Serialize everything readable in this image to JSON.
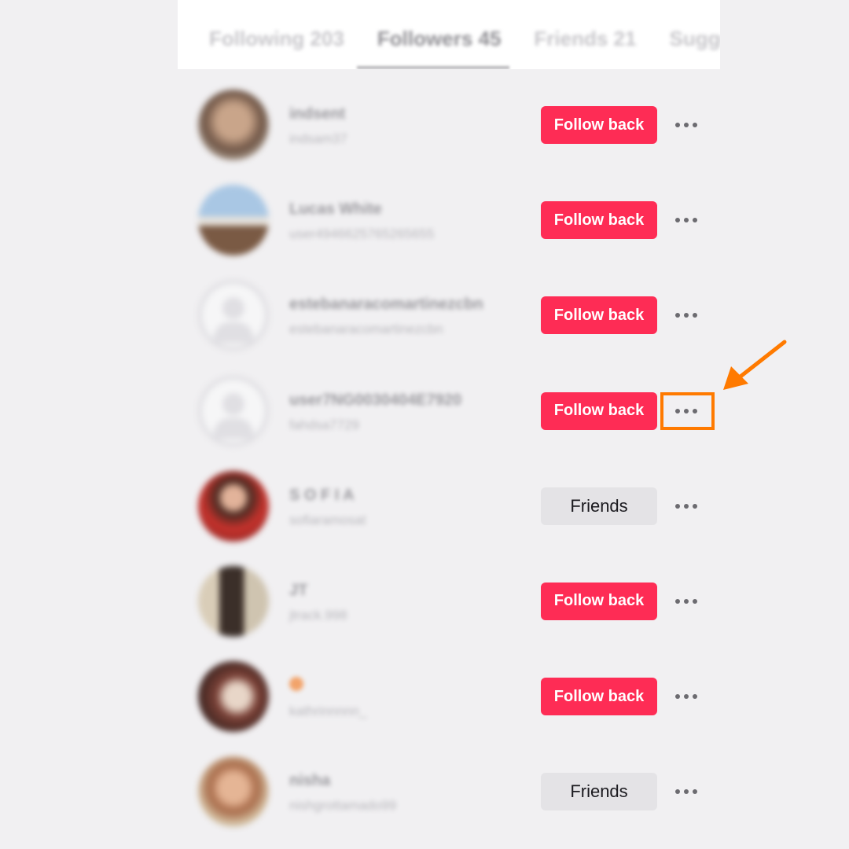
{
  "tabs": [
    {
      "label": "Following 203",
      "active": false
    },
    {
      "label": "Followers 45",
      "active": true
    },
    {
      "label": "Friends 21",
      "active": false
    },
    {
      "label": "Suggested",
      "active": false
    }
  ],
  "followers": [
    {
      "display_name": "indsent",
      "username": "indsam37",
      "button": "Follow back",
      "button_type": "follow",
      "avatar_color": "#9a7b64"
    },
    {
      "display_name": "Lucas White",
      "username": "user4946625765265655",
      "button": "Follow back",
      "button_type": "follow",
      "avatar_color": "#8ba9c8"
    },
    {
      "display_name": "estebanaracomartinezcbn",
      "username": "estebanaracomartinezcbn",
      "button": "Follow back",
      "button_type": "follow",
      "avatar_color": null
    },
    {
      "display_name": "user7NG0030404E7920",
      "username": "fahdsa7729",
      "button": "Follow back",
      "button_type": "follow",
      "avatar_color": null
    },
    {
      "display_name": "S O F I A",
      "username": "sofiaramosat",
      "button": "Friends",
      "button_type": "friends",
      "avatar_color": "#c6322c"
    },
    {
      "display_name": "JT",
      "username": "jtrack.998",
      "button": "Follow back",
      "button_type": "follow",
      "avatar_color": "#5a4a3d"
    },
    {
      "display_name": "",
      "username": "kathrinnnnn_",
      "button": "Follow back",
      "button_type": "follow",
      "avatar_color": "#7a4036"
    },
    {
      "display_name": "nisha",
      "username": "nishgrottamado99",
      "button": "Friends",
      "button_type": "friends",
      "avatar_color": "#d0a27a"
    }
  ],
  "more_icon": "ellipsis-horizontal-icon",
  "highlight_color": "#ff7a00",
  "follow_button_color": "#fe2c55"
}
